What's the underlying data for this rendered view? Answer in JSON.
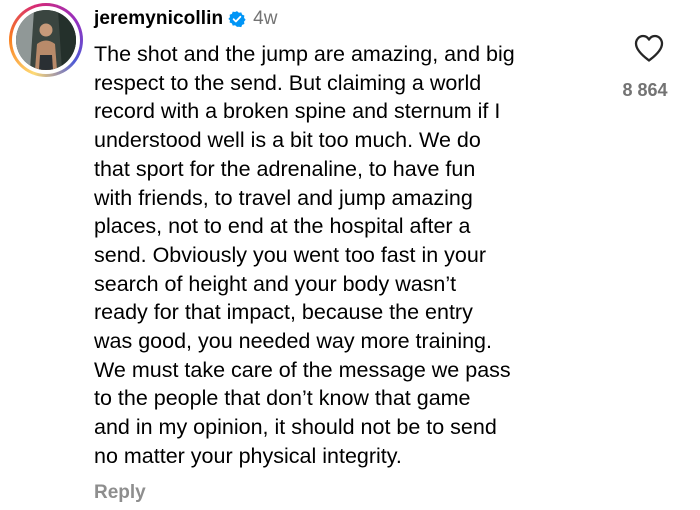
{
  "comment": {
    "username": "jeremynicollin",
    "timestamp": "4w",
    "verified": true,
    "text": "The shot and the jump are amazing, and big\nrespect to the send. But claiming a world\nrecord with a broken spine and sternum if I\nunderstood well is a bit too much. We do\nthat sport for the adrenaline, to have fun\nwith friends, to travel and jump amazing\nplaces, not to end at the hospital after a\nsend. Obviously you went too fast in your\nsearch of height and your body wasn’t\nready for that impact, because the entry\nwas good, you needed way more training.\nWe must take care of the message we pass\nto the people that don’t know that game\nand in my opinion, it should not be to send\nno matter your physical integrity.",
    "reply_label": "Reply",
    "like_count": "8 864"
  },
  "icons": {
    "avatar": "avatar",
    "verified": "verified-badge-icon",
    "like": "heart-outline-icon"
  },
  "colors": {
    "verified_blue": "#0095f6",
    "secondary_text": "#737373",
    "reply_text": "#8e8e8e"
  }
}
